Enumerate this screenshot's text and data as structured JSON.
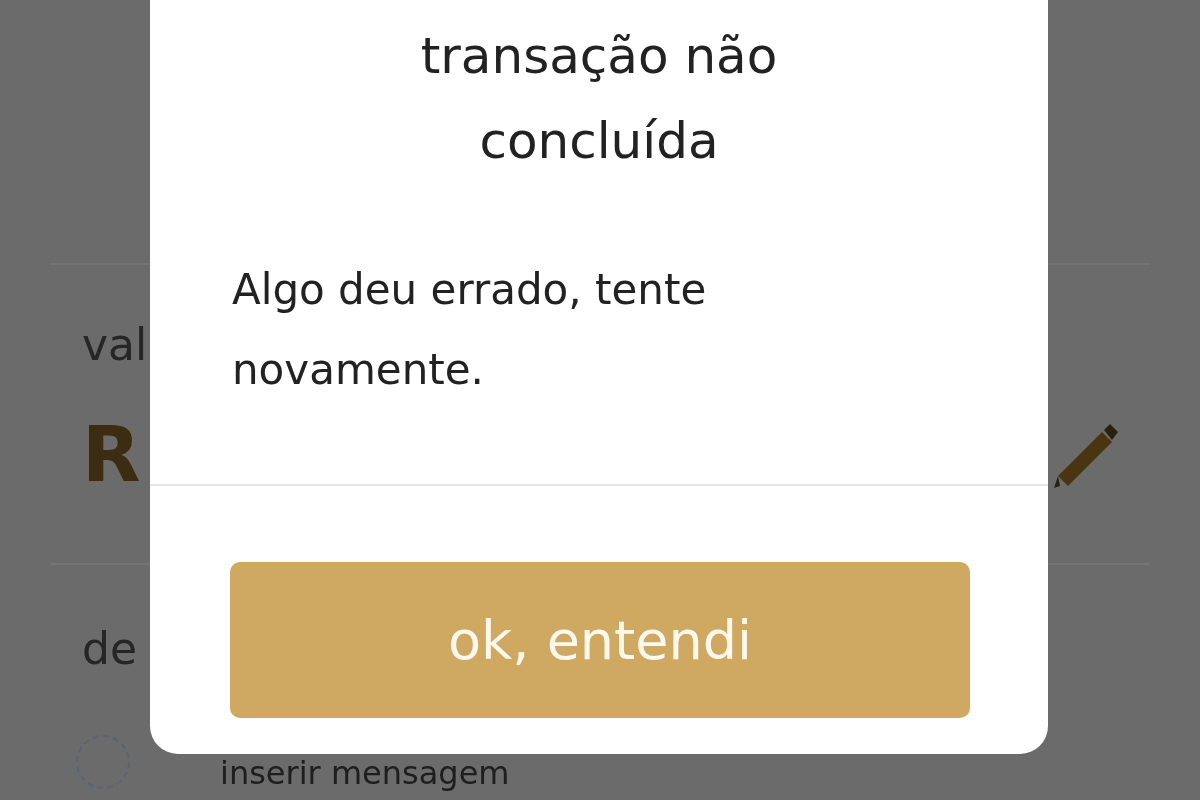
{
  "background": {
    "amount_label": "val",
    "amount_value": "R",
    "description_label": "de",
    "message_action": "inserir mensagem"
  },
  "dialog": {
    "title": "transação não concluída",
    "message": "Algo deu errado, tente novamente.",
    "button": "ok, entendi"
  }
}
